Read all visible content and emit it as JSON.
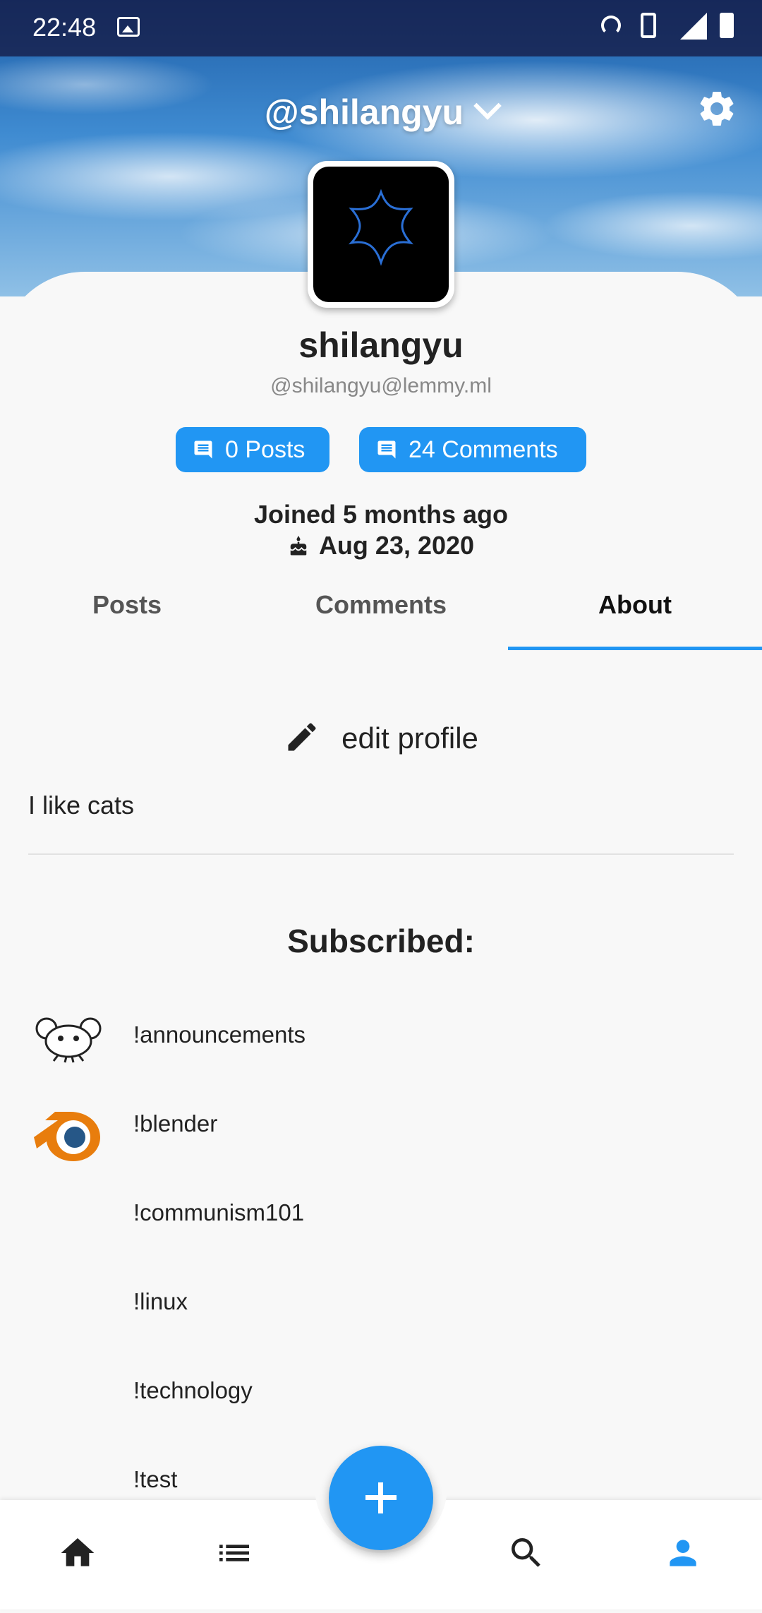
{
  "status_bar": {
    "time": "22:48"
  },
  "header": {
    "handle": "@shilangyu"
  },
  "profile": {
    "display_name": "shilangyu",
    "full_handle": "@shilangyu@lemmy.ml",
    "posts_chip": "0 Posts",
    "comments_chip": "24 Comments",
    "joined": "Joined 5 months ago",
    "date": "Aug 23, 2020"
  },
  "tabs": [
    {
      "label": "Posts"
    },
    {
      "label": "Comments"
    },
    {
      "label": "About"
    }
  ],
  "about": {
    "edit_label": "edit profile",
    "bio": "I like cats",
    "subscribed_title": "Subscribed:",
    "communities": [
      {
        "name": "!announcements",
        "icon": "lemmy-mouse-icon"
      },
      {
        "name": "!blender",
        "icon": "blender-icon"
      },
      {
        "name": "!communism101",
        "icon": ""
      },
      {
        "name": "!linux",
        "icon": ""
      },
      {
        "name": "!technology",
        "icon": ""
      },
      {
        "name": "!test",
        "icon": ""
      }
    ]
  },
  "colors": {
    "accent": "#2196f3",
    "blender_orange": "#e87d0d",
    "blender_blue": "#265787"
  }
}
